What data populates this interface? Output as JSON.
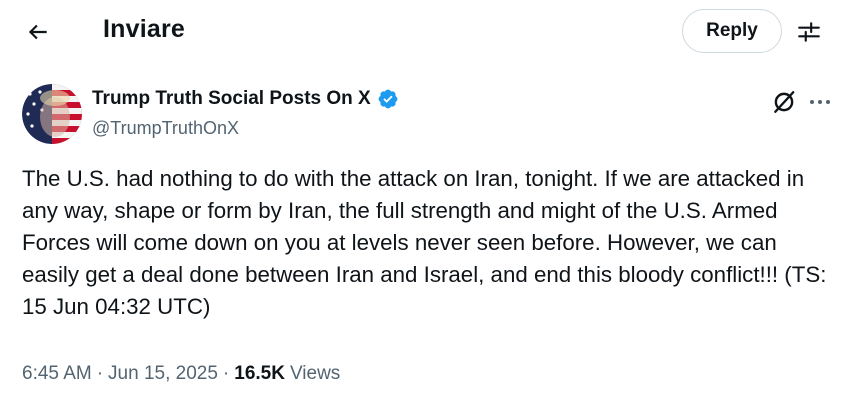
{
  "header": {
    "back_icon": "arrow-left-icon",
    "title": "Inviare",
    "reply_label": "Reply",
    "settings_icon": "sliders-icon"
  },
  "post": {
    "author_name": "Trump Truth Social Posts On X",
    "verified_icon": "verified-badge-icon",
    "verified_color": "#1d9bf0",
    "handle": "@TrumpTruthOnX",
    "grok_icon": "grok-icon",
    "more_icon": "more-horizontal-icon",
    "text": "The U.S. had nothing to do with the attack on Iran, tonight. If we are attacked in any way, shape or form by Iran, the full strength and might of the U.S. Armed Forces will come down on you at levels never seen before. However, we can easily get a deal done between Iran and Israel, and end this bloody conflict!!! (TS: 15 Jun 04:32 UTC)",
    "time": "6:45 AM",
    "date": "Jun 15, 2025",
    "separator": "·",
    "views_count": "16.5K",
    "views_label": "Views"
  }
}
